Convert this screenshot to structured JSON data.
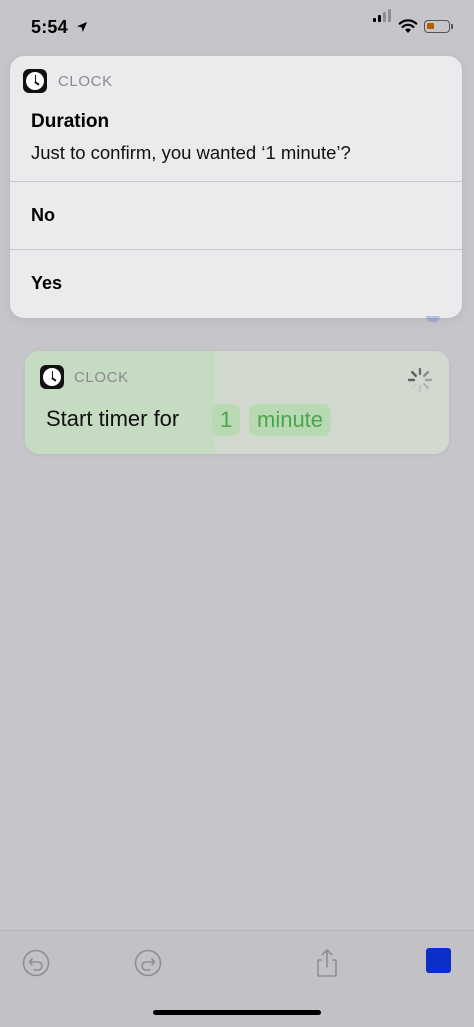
{
  "status_bar": {
    "time": "5:54"
  },
  "alert": {
    "app_label": "CLOCK",
    "title": "Duration",
    "message": "Just to confirm, you wanted ‘1 minute’?",
    "options": [
      {
        "label": "No"
      },
      {
        "label": "Yes"
      }
    ]
  },
  "action": {
    "app_label": "CLOCK",
    "text": "Start timer for",
    "amount": "1",
    "unit": "minute"
  },
  "toolbar": {
    "icons": [
      "undo-icon",
      "redo-icon",
      "share-icon",
      "stop-icon"
    ]
  },
  "colors": {
    "stop": "#0d2fc9",
    "token_text": "#4aa649",
    "token_bg": "#b9d9b4"
  }
}
